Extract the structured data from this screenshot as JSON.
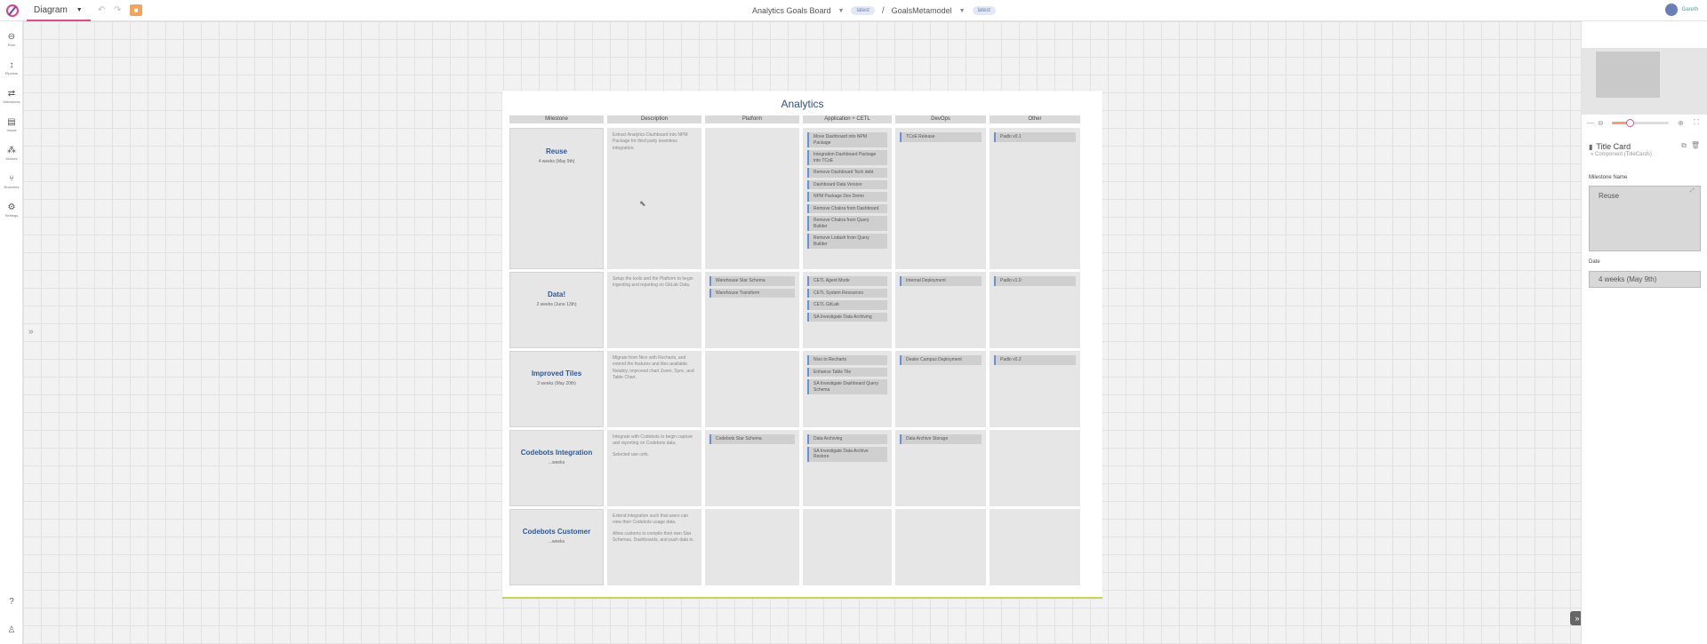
{
  "topbar": {
    "view": "Diagram",
    "board": "Analytics Goals Board",
    "board_badge": "latest",
    "model": "GoalsMetamodel",
    "model_badge": "latest",
    "user": "Gareth"
  },
  "rail": [
    {
      "label": "Role",
      "icon": "lock-icon"
    },
    {
      "label": "Pipeline",
      "icon": "pipeline-icon"
    },
    {
      "label": "Milestones",
      "icon": "milestones-icon"
    },
    {
      "label": "Visual",
      "icon": "visual-icon"
    },
    {
      "label": "Models",
      "icon": "models-icon"
    },
    {
      "label": "Branches",
      "icon": "branches-icon"
    },
    {
      "label": "Settings",
      "icon": "settings-icon"
    }
  ],
  "board": {
    "title": "Analytics",
    "columns": [
      "Milestone",
      "Description",
      "Platform",
      "Application + CETL",
      "DevOps",
      "Other"
    ],
    "rows": [
      {
        "milestone": "Reuse",
        "date": "4 weeks (May 9th)",
        "description": [
          "Extract Analytics Dashboard into NPM Package for third party seamless integration."
        ],
        "platform": [],
        "application": [
          "Move Dashboard into NPM Package",
          "Integration Dashboard Package into TCoE",
          "Remove Dashboard Tech debt",
          "Dashboard Data Version",
          "NPM Package Dev Demo",
          "Remove Chakra from Dashboard",
          "Remove Chakra from Query Builder",
          "Remove Lodash from Query Builder"
        ],
        "devops": [
          "TCoE Release"
        ],
        "other": [
          "Padlo v0.1"
        ]
      },
      {
        "milestone": "Data!",
        "date": "2 weeks (June 13th)",
        "description": [
          "Setup the tools and the Platform to begin ingesting and reporting on GitLab Data."
        ],
        "platform": [
          "Warehouse Star Schema",
          "Warehouse Transform"
        ],
        "application": [
          "CETL Agent Mode",
          "CETL System Resources",
          "CETL GitLab",
          "SA Investigate Data Archiving"
        ],
        "devops": [
          "Internal Deployment"
        ],
        "other": [
          "Padlo v1.0"
        ]
      },
      {
        "milestone": "Improved Tiles",
        "date": "3 weeks (May 20th)",
        "description": [
          "Migrate from Nivo with Recharts, and extend the features and tiles available. Notably, improved chart Zoom, Sync, and Table Chart."
        ],
        "platform": [],
        "application": [
          "Nivo to Recharts",
          "Enhance Table Tile",
          "SA Investigate Dashboard Query Schema"
        ],
        "devops": [
          "Dealer Campus Deployment"
        ],
        "other": [
          "Padlo v0.2"
        ]
      },
      {
        "milestone": "Codebots Integration",
        "date": "...weeks",
        "description": [
          "Integrate with Codebots to begin capture and reporting on Codebots data.",
          "Selected use cefs."
        ],
        "platform": [
          "Codebots Star Schema"
        ],
        "application": [
          "Data Archiving",
          "SA Investigate Data Archive Restore"
        ],
        "devops": [
          "Data Archive Storage"
        ],
        "other": []
      },
      {
        "milestone": "Codebots Customer",
        "date": "...weeks",
        "description": [
          "Extend integration such that users can view their Codebots usage data.",
          "Allow customs to compile their own Star Schemas, Dashboards, and push data in."
        ],
        "platform": [],
        "application": [],
        "devops": [],
        "other": []
      }
    ]
  },
  "panel": {
    "title": "Title Card",
    "subtitle": "Component (TitleCards)",
    "milestone_label": "Milestone Name",
    "milestone_value": "Reuse",
    "date_label": "Date",
    "date_value": "4 weeks (May 9th)",
    "zoom_level": 0.32
  },
  "colors": {
    "accent": "#d94f86",
    "title_blue": "#2e4f96",
    "card_border": "#6a8fd8",
    "lock_orange": "#f2a45b"
  }
}
